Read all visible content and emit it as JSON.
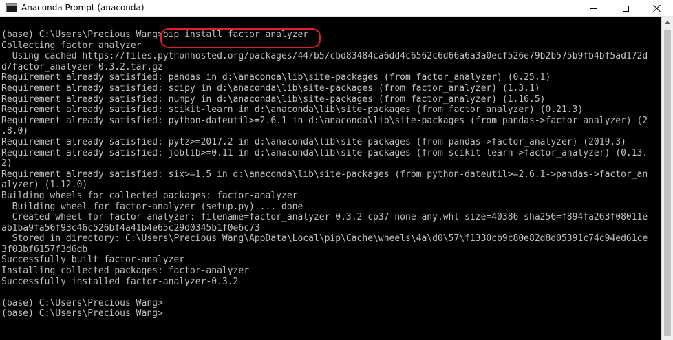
{
  "window": {
    "title": "Anaconda Prompt (anaconda)",
    "icon": "console-icon",
    "controls": {
      "minimize": "minimize-icon",
      "maximize": "maximize-icon",
      "close": "close-icon"
    }
  },
  "colors": {
    "console_background": "#000000",
    "console_text": "#c0c0c0",
    "highlight": "#e0202a",
    "titlebar": "#ffffff"
  },
  "console": {
    "lines": [
      "(base) C:\\Users\\Precious Wang>pip install factor_analyzer",
      "Collecting factor_analyzer",
      "  Using cached https://files.pythonhosted.org/packages/44/b5/cbd83484ca6dd4c6562c6d66a6a3a0ecf526e79b2b575b9fb4bf5ad172d",
      "d/factor_analyzer-0.3.2.tar.gz",
      "Requirement already satisfied: pandas in d:\\anaconda\\lib\\site-packages (from factor_analyzer) (0.25.1)",
      "Requirement already satisfied: scipy in d:\\anaconda\\lib\\site-packages (from factor_analyzer) (1.3.1)",
      "Requirement already satisfied: numpy in d:\\anaconda\\lib\\site-packages (from factor_analyzer) (1.16.5)",
      "Requirement already satisfied: scikit-learn in d:\\anaconda\\lib\\site-packages (from factor_analyzer) (0.21.3)",
      "Requirement already satisfied: python-dateutil>=2.6.1 in d:\\anaconda\\lib\\site-packages (from pandas->factor_analyzer) (2",
      ".8.0)",
      "Requirement already satisfied: pytz>=2017.2 in d:\\anaconda\\lib\\site-packages (from pandas->factor_analyzer) (2019.3)",
      "Requirement already satisfied: joblib>=0.11 in d:\\anaconda\\lib\\site-packages (from scikit-learn->factor_analyzer) (0.13.",
      "2)",
      "Requirement already satisfied: six>=1.5 in d:\\anaconda\\lib\\site-packages (from python-dateutil>=2.6.1->pandas->factor_an",
      "alyzer) (1.12.0)",
      "Building wheels for collected packages: factor-analyzer",
      "  Building wheel for factor-analyzer (setup.py) ... done",
      "  Created wheel for factor-analyzer: filename=factor_analyzer-0.3.2-cp37-none-any.whl size=40386 sha256=f894fa263f08011e",
      "ab1ba9fa56f93c46c526bf4a41b4e65c29d0345b1f0e6c73",
      "  Stored in directory: C:\\Users\\Precious Wang\\AppData\\Local\\pip\\Cache\\wheels\\4a\\d0\\57\\f1330cb9c80e82d8d05391c74c94ed61ce",
      "3f03bf6157f3d6db",
      "Successfully built factor-analyzer",
      "Installing collected packages: factor-analyzer",
      "Successfully installed factor-analyzer-0.3.2",
      "",
      "(base) C:\\Users\\Precious Wang>",
      "(base) C:\\Users\\Precious Wang>"
    ]
  }
}
